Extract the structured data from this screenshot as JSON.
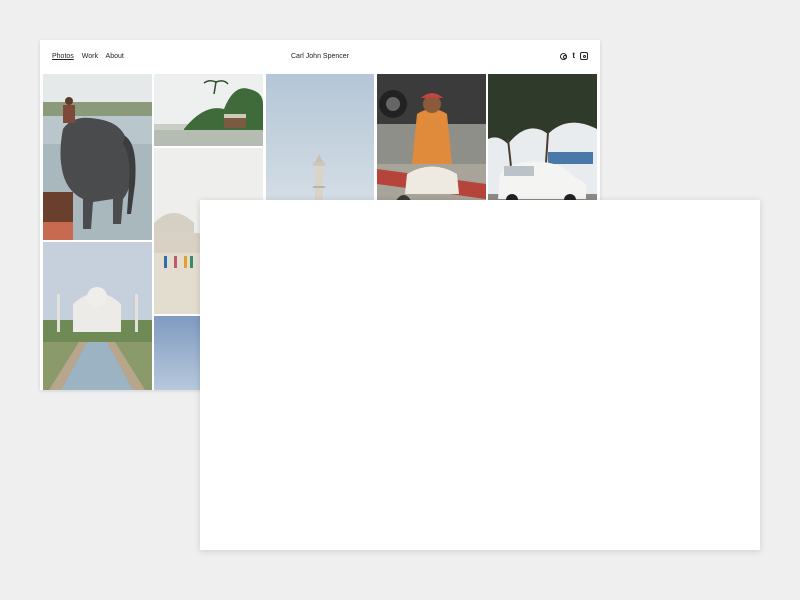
{
  "nav": {
    "items": [
      {
        "label": "Photos"
      },
      {
        "label": "Work"
      },
      {
        "label": "About"
      }
    ]
  },
  "site": {
    "title": "Carl John Spencer"
  },
  "social": {
    "icons": [
      "dribbble-icon",
      "tumblr-icon",
      "instagram-icon"
    ],
    "tumblr_glyph": "t"
  },
  "gallery": {
    "photos": [
      {
        "subject": "elephant-in-river"
      },
      {
        "subject": "backwater-houseboat"
      },
      {
        "subject": "minaret-sky"
      },
      {
        "subject": "snake-charmer"
      },
      {
        "subject": "white-ambassador-car"
      },
      {
        "subject": "taj-mahal-reflection-pool"
      },
      {
        "subject": "taj-mahal-visitors"
      },
      {
        "subject": "blue-sky"
      }
    ]
  }
}
